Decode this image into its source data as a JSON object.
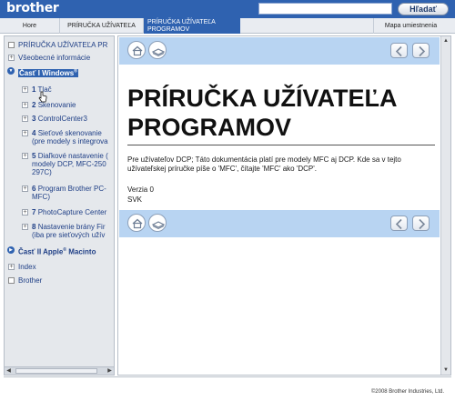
{
  "header": {
    "logo": "brother",
    "search_placeholder": "",
    "search_button": "Hľadať"
  },
  "nav": {
    "tabs": [
      {
        "label": "Hore"
      },
      {
        "label": "PRÍRUČKA UŽÍVATEĽA"
      },
      {
        "label": "PRÍRUČKA UŽÍVATEĽA PROGRAMOV"
      },
      {
        "label": "Mapa umiestnenia"
      }
    ]
  },
  "sidebar": {
    "items": [
      {
        "label": "PRÍRUČKA UŽÍVATEĽA PR"
      },
      {
        "label": "Všeobecné informácie"
      },
      {
        "label": "Časť I Windows",
        "sup": "®"
      },
      {
        "num": "1",
        "label": "Tlač"
      },
      {
        "num": "2",
        "label": "Skenovanie"
      },
      {
        "num": "3",
        "label": "ControlCenter3"
      },
      {
        "num": "4",
        "label": "Sieťové skenovanie",
        "label2": "(pre modely s integrova"
      },
      {
        "num": "5",
        "label": "Diaľkové nastavenie (",
        "label2": "modely DCP, MFC-250",
        "label3": "297C)"
      },
      {
        "num": "6",
        "label": "Program Brother PC-",
        "label2": "MFC)"
      },
      {
        "num": "7",
        "label": "PhotoCapture Center"
      },
      {
        "num": "8",
        "label": "Nastavenie brány Fir",
        "label2": "(iba pre sieťových užív"
      },
      {
        "label": "Časť II Apple",
        "sup": "®",
        "label_after": " Macinto"
      },
      {
        "label": "Index"
      },
      {
        "label": "Brother"
      }
    ]
  },
  "main": {
    "title": "PRÍRUČKA UŽÍVATEĽA PROGRAMOV",
    "paragraph": "Pre užívateľov DCP; Táto dokumentácia platí pre modely MFC aj DCP. Kde sa v tejto užívateľskej príručke píše o 'MFC', čítajte 'MFC' ako 'DCP'.",
    "version": "Verzia 0",
    "language": "SVK"
  },
  "footer": {
    "copyright": "©2008 Brother Industries, Ltd."
  },
  "colors": {
    "brand_blue": "#2f62b0",
    "band_blue": "#b8d4f2",
    "sidebar_bg": "#e5e8ec"
  },
  "icons": [
    "home-icon",
    "book-icon",
    "prev-arrow-icon",
    "next-arrow-icon",
    "pointer-cursor-icon"
  ]
}
